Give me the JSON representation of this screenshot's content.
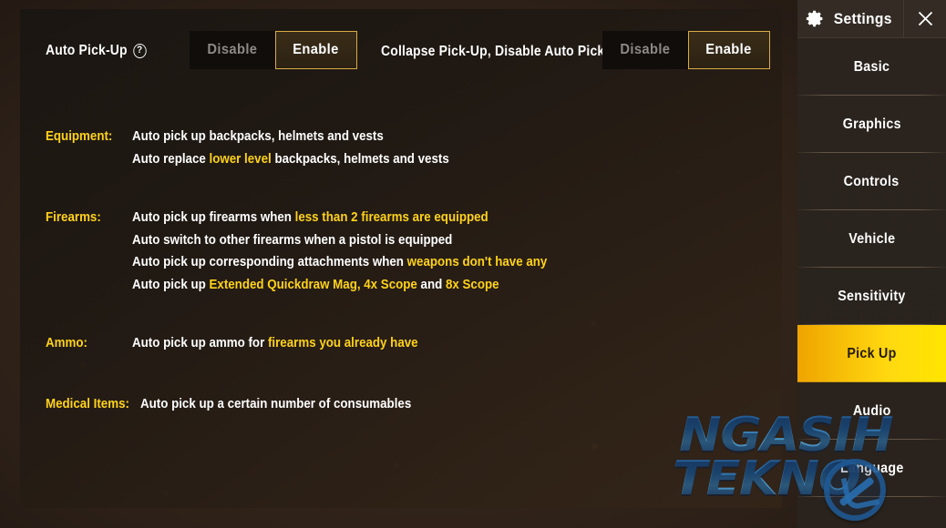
{
  "window": {
    "title": "Settings",
    "gear_icon": "gear-icon",
    "close_icon": "close-x-icon"
  },
  "toggles": [
    {
      "id": "auto-pick-up",
      "label": "Auto Pick-Up",
      "help_icon": "question-mark-icon",
      "help_glyph": "?",
      "options": [
        "Disable",
        "Enable"
      ],
      "selected": "Enable"
    },
    {
      "id": "collapse-pick-up",
      "label": "Collapse Pick-Up, Disable Auto Pick-Up",
      "options": [
        "Disable",
        "Enable"
      ],
      "selected": "Enable"
    }
  ],
  "sections": [
    {
      "key": "Equipment:",
      "lines": [
        [
          {
            "t": "Auto pick up backpacks, helmets and vests",
            "hl": false
          }
        ],
        [
          {
            "t": "Auto replace ",
            "hl": false
          },
          {
            "t": "lower level",
            "hl": true
          },
          {
            "t": " backpacks, helmets and vests",
            "hl": false
          }
        ]
      ]
    },
    {
      "key": "Firearms:",
      "lines": [
        [
          {
            "t": "Auto pick up firearms when ",
            "hl": false
          },
          {
            "t": "less than 2 firearms are equipped",
            "hl": true
          }
        ],
        [
          {
            "t": "Auto switch to other firearms when a pistol is equipped",
            "hl": false
          }
        ],
        [
          {
            "t": "Auto pick up corresponding attachments when ",
            "hl": false
          },
          {
            "t": "weapons don't have any",
            "hl": true
          }
        ],
        [
          {
            "t": "Auto pick up ",
            "hl": false
          },
          {
            "t": "Extended Quickdraw Mag, 4x Scope",
            "hl": true
          },
          {
            "t": " and ",
            "hl": false
          },
          {
            "t": "8x Scope",
            "hl": true
          }
        ]
      ]
    },
    {
      "key": "Ammo:",
      "lines": [
        [
          {
            "t": "Auto pick up ammo for ",
            "hl": false
          },
          {
            "t": "firearms you already have",
            "hl": true
          }
        ]
      ]
    },
    {
      "key": "Medical Items:",
      "lines": [
        [
          {
            "t": "Auto pick up a certain number of consumables",
            "hl": false
          }
        ]
      ]
    }
  ],
  "sidebar": {
    "items": [
      {
        "label": "Basic",
        "selected": false
      },
      {
        "label": "Graphics",
        "selected": false
      },
      {
        "label": "Controls",
        "selected": false
      },
      {
        "label": "Vehicle",
        "selected": false
      },
      {
        "label": "Sensitivity",
        "selected": false
      },
      {
        "label": "Pick Up",
        "selected": true
      },
      {
        "label": "Audio",
        "selected": false
      },
      {
        "label": "Language",
        "selected": false
      }
    ]
  },
  "watermark": {
    "line1": "NGASIH",
    "line2": "TEKNO"
  },
  "colors": {
    "accent_yellow": "#ffd21a",
    "selected_gradient_start": "#efa400",
    "selected_gradient_end": "#ffe500",
    "enable_border": "#d8ab45",
    "panel_bg": "#221a13",
    "sidebar_bg": "#2b241e",
    "text_white": "#ffffff",
    "text_muted": "#8d8a86"
  }
}
